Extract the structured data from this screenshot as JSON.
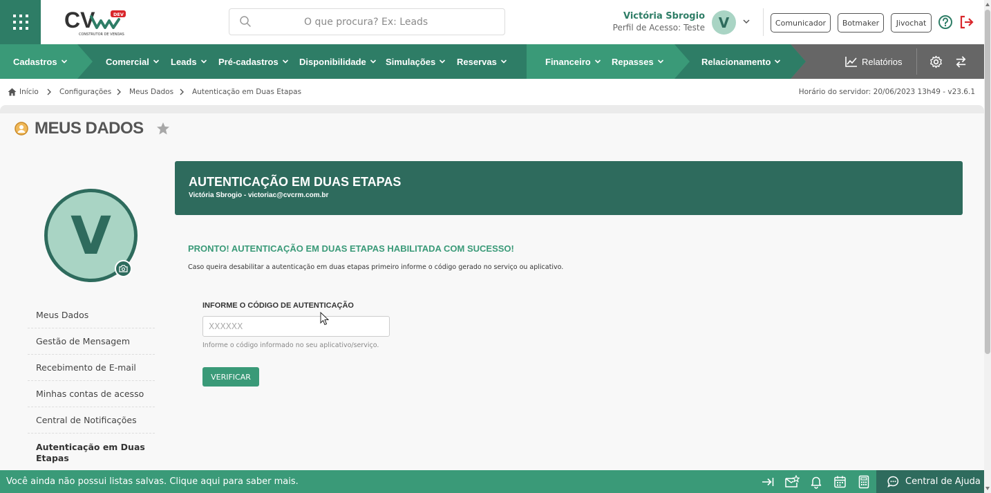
{
  "topbar": {
    "search_placeholder": "O que procura? Ex: Leads",
    "user_name": "Victória Sbrogio",
    "user_profile": "Perfil de Acesso: Teste",
    "avatar_letter": "V",
    "buttons": [
      "Comunicador",
      "Botmaker",
      "Jivochat"
    ],
    "logo_text": "CV",
    "logo_badge": "DEV",
    "logo_tagline": "CONSTRUTOR DE VENDAS"
  },
  "nav": {
    "items": [
      "Cadastros",
      "Comercial",
      "Leads",
      "Pré-cadastros",
      "Disponibilidade",
      "Simulações",
      "Reservas",
      "Financeiro",
      "Repasses",
      "Relacionamento",
      "Relatórios"
    ]
  },
  "breadcrumb": {
    "items": [
      "Início",
      "Configurações",
      "Meus Dados",
      "Autenticação em Duas Etapas"
    ],
    "server_time": "Horário do servidor: 20/06/2023 13h49 - v23.6.1"
  },
  "page": {
    "title": "MEUS DADOS",
    "avatar_letter": "V"
  },
  "side_menu": {
    "items": [
      "Meus Dados",
      "Gestão de Mensagem",
      "Recebimento de E-mail",
      "Minhas contas de acesso",
      "Central de Notificações",
      "Autenticação em Duas Etapas"
    ]
  },
  "card": {
    "title": "AUTENTICAÇÃO EM DUAS ETAPAS",
    "subtitle": "Victória Sbrogio - victoriac@cvcrm.com.br",
    "success_title": "PRONTO! AUTENTICAÇÃO EM DUAS ETAPAS HABILITADA COM SUCESSO!",
    "success_desc": "Caso queira desabilitar a autenticação em duas etapas primeiro informe o código gerado no serviço ou aplicativo.",
    "field_label": "INFORME O CÓDIGO DE AUTENTICAÇÃO",
    "field_placeholder": "XXXXXX",
    "field_help": "Informe o código informado no seu aplicativo/serviço.",
    "verify_label": "VERIFICAR"
  },
  "bottom": {
    "message": "Você ainda não possui listas salvas. Clique aqui para saber mais.",
    "help_center": "Central de Ajuda"
  },
  "colors": {
    "primary": "#3a9a78",
    "dark": "#2e6b5d",
    "logout": "#d9262b"
  }
}
